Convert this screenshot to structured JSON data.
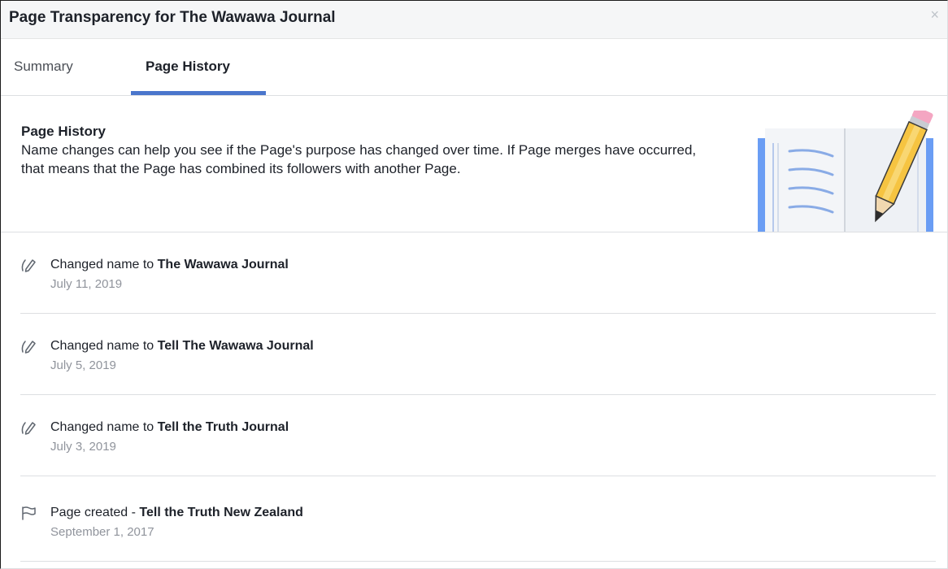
{
  "dialog": {
    "title": "Page Transparency for The Wawawa Journal",
    "close_symbol": "×"
  },
  "tabs": [
    {
      "label": "Summary",
      "active": false
    },
    {
      "label": "Page History",
      "active": true
    }
  ],
  "colors": {
    "accent": "#4a76cc",
    "title_bar": "#f5f6f7",
    "muted_text": "#90949c"
  },
  "section": {
    "title": "Page History",
    "description": "Name changes can help you see if the Page's purpose has changed over time. If Page merges have occurred, that means that the Page has combined its followers with another Page."
  },
  "history": [
    {
      "icon": "pencil-icon",
      "prefix": "Changed name to ",
      "name": "The Wawawa Journal",
      "date": "July 11, 2019"
    },
    {
      "icon": "pencil-icon",
      "prefix": "Changed name to ",
      "name": "Tell The Wawawa Journal",
      "date": "July 5, 2019"
    },
    {
      "icon": "pencil-icon",
      "prefix": "Changed name to ",
      "name": "Tell the Truth Journal",
      "date": "July 3, 2019"
    },
    {
      "icon": "flag-icon",
      "prefix": "Page created - ",
      "name": "Tell the Truth New Zealand",
      "date": "September 1, 2017"
    }
  ]
}
